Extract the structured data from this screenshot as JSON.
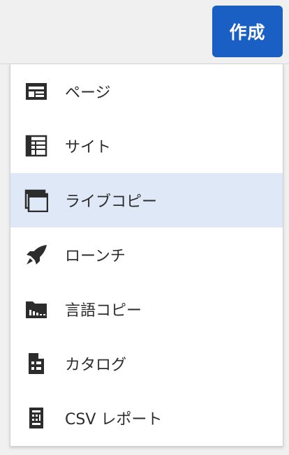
{
  "header": {
    "create_label": "作成"
  },
  "menu": {
    "items": [
      {
        "label": "ページ",
        "icon": "page-icon",
        "selected": false
      },
      {
        "label": "サイト",
        "icon": "site-icon",
        "selected": false
      },
      {
        "label": "ライブコピー",
        "icon": "live-copy-icon",
        "selected": true
      },
      {
        "label": "ローンチ",
        "icon": "launch-icon",
        "selected": false
      },
      {
        "label": "言語コピー",
        "icon": "language-copy-icon",
        "selected": false
      },
      {
        "label": "カタログ",
        "icon": "catalog-icon",
        "selected": false
      },
      {
        "label": "CSV レポート",
        "icon": "csv-report-icon",
        "selected": false
      }
    ]
  },
  "colors": {
    "accent": "#1a5fc4",
    "selected_background": "#dfe8f7",
    "icon": "#2c2c2c"
  }
}
